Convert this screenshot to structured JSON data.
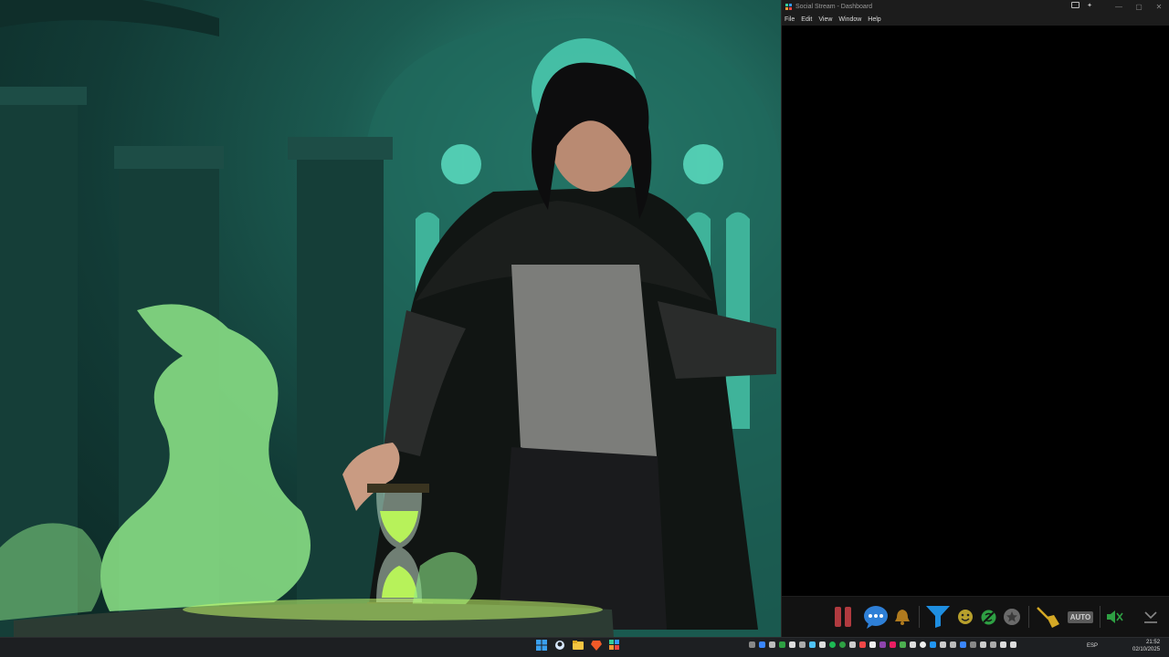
{
  "window": {
    "title": "Social Stream - Dashboard",
    "controls": [
      "—",
      "▢",
      "✕"
    ]
  },
  "menu": [
    "File",
    "Edit",
    "View",
    "Window",
    "Help"
  ],
  "toolbar": {
    "buttons": [
      {
        "name": "pause-icon",
        "color": "#b03a3f"
      },
      {
        "name": "chat-bubble-icon",
        "color": "#2e7fd6"
      },
      {
        "name": "bell-icon",
        "color": "#b07a1e"
      },
      {
        "name": "filter-icon",
        "color": "#1e8ee0"
      },
      {
        "name": "emoji-icon",
        "color": "#b8a02c"
      },
      {
        "name": "translate-icon",
        "color": "#2ea043"
      },
      {
        "name": "star-icon",
        "color": "#6a6a6a"
      },
      {
        "name": "broom-icon",
        "color": "#d4a825"
      },
      {
        "name": "auto-icon",
        "label": "AUTO"
      },
      {
        "name": "mute-icon",
        "color": "#2ea043"
      },
      {
        "name": "download-icon",
        "color": "#888888"
      }
    ]
  },
  "taskbar": {
    "language": "ESP",
    "time": "21:52",
    "date": "02/10/2025"
  },
  "colors": {
    "wallpaper_accent": "#2f8f7d",
    "flame": "#9cf27a",
    "taskbar_bg": "#1d1f22"
  }
}
